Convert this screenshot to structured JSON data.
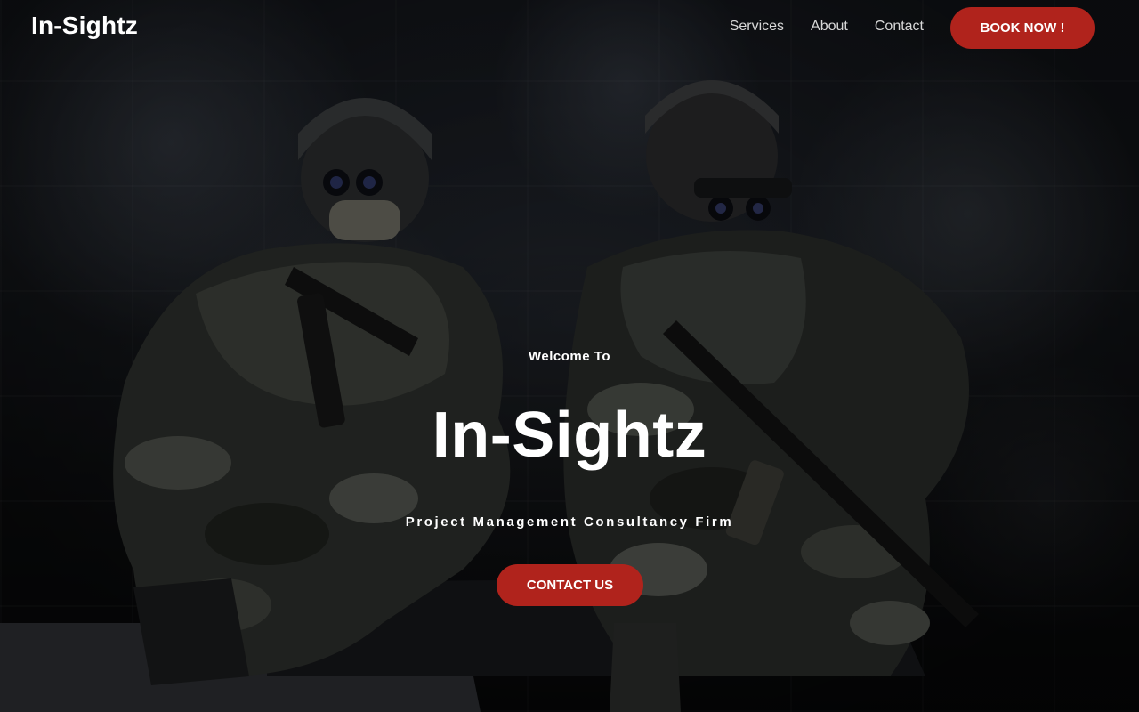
{
  "header": {
    "logo": "In-Sightz",
    "nav": [
      "Services",
      "About",
      "Contact"
    ],
    "book_button": "BOOK NOW !"
  },
  "hero": {
    "welcome": "Welcome To",
    "title": "In-Sightz",
    "subtitle": "Project Management Consultancy Firm",
    "contact_button": "CONTACT US",
    "background_image": "two soldiers in camouflage with night-vision helmets and rifles sitting against a dark concrete wall"
  },
  "colors": {
    "accent": "#b0231c",
    "text": "#ffffff",
    "nav_text": "#d8d8d8",
    "background": "#1a1d22"
  }
}
